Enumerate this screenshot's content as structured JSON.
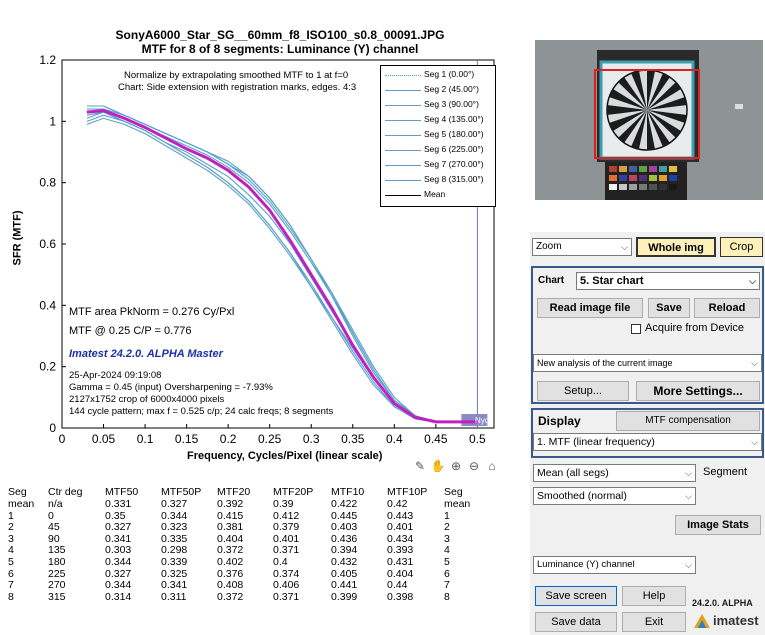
{
  "chart_title": {
    "line1": "SonyA6000_Star_SG__60mm_f8_ISO100_s0.8_00091.JPG",
    "line2": "MTF for 8 of 8 segments:  Luminance (Y) channel"
  },
  "plot_notes": {
    "normalize": "Normalize by extrapolating smoothed MTF to 1 at f=0",
    "chart_type": "Chart: Side extension with registration marks, edges. 4:3",
    "mtf_area": "MTF area PkNorm = 0.276 Cy/Pxl",
    "mtf_at": "MTF @ 0.25 C/P = 0.776",
    "version": "Imatest 24.2.0. ALPHA Master",
    "date": "25-Apr-2024 09:19:08",
    "gamma": "Gamma = 0.45 (input)  Oversharpening = -7.93%",
    "crop": "2127x1752 crop of 6000x4000 pixels",
    "pattern": "144 cycle pattern; max f = 0.525 c/p;  24 calc freqs;  8 segments",
    "nyq": "Nyq"
  },
  "legend": [
    "Seg 1 (0.00°)",
    "Seg 2 (45.00°)",
    "Seg 3 (90.00°)",
    "Seg 4 (135.00°)",
    "Seg 5 (180.00°)",
    "Seg 6 (225.00°)",
    "Seg 7 (270.00°)",
    "Seg 8 (315.00°)",
    "Mean"
  ],
  "chart_data": {
    "type": "line",
    "title": "SonyA6000_Star_SG__60mm_f8_ISO100_s0.8_00091.JPG — MTF for 8 of 8 segments:  Luminance (Y) channel",
    "xlabel": "Frequency, Cycles/Pixel (linear scale)",
    "ylabel": "SFR (MTF)",
    "xlim": [
      0,
      0.52
    ],
    "ylim": [
      0,
      1.2
    ],
    "xticks": [
      "0",
      "0.05",
      "0.1",
      "0.15",
      "0.2",
      "0.25",
      "0.3",
      "0.35",
      "0.4",
      "0.45",
      "0.5"
    ],
    "yticks": [
      "0",
      "0.2",
      "0.4",
      "0.6",
      "0.8",
      "1",
      "1.2"
    ],
    "nyquist": 0.5,
    "x": [
      0.03,
      0.05,
      0.075,
      0.1,
      0.125,
      0.15,
      0.175,
      0.2,
      0.225,
      0.25,
      0.275,
      0.3,
      0.325,
      0.35,
      0.375,
      0.4,
      0.425,
      0.45,
      0.475,
      0.5
    ],
    "series": [
      {
        "name": "Seg 1 (0.00°)",
        "color": "#5aa0c8",
        "values": [
          1.03,
          1.04,
          1.01,
          0.98,
          0.95,
          0.92,
          0.89,
          0.85,
          0.8,
          0.73,
          0.64,
          0.54,
          0.43,
          0.31,
          0.19,
          0.09,
          0.04,
          0.02,
          0.02,
          0.02
        ]
      },
      {
        "name": "Seg 2 (45.00°)",
        "color": "#5aa0c8",
        "values": [
          1.0,
          1.02,
          1.0,
          0.97,
          0.93,
          0.89,
          0.85,
          0.8,
          0.74,
          0.66,
          0.57,
          0.46,
          0.35,
          0.24,
          0.14,
          0.07,
          0.03,
          0.02,
          0.02,
          0.02
        ]
      },
      {
        "name": "Seg 3 (90.00°)",
        "color": "#5aa0c8",
        "values": [
          1.05,
          1.05,
          1.02,
          0.99,
          0.96,
          0.93,
          0.9,
          0.87,
          0.82,
          0.75,
          0.66,
          0.55,
          0.43,
          0.3,
          0.18,
          0.09,
          0.04,
          0.02,
          0.02,
          0.02
        ]
      },
      {
        "name": "Seg 4 (135.00°)",
        "color": "#5aa0c8",
        "values": [
          0.99,
          1.01,
          0.99,
          0.96,
          0.92,
          0.88,
          0.84,
          0.79,
          0.73,
          0.65,
          0.56,
          0.46,
          0.36,
          0.26,
          0.16,
          0.08,
          0.03,
          0.02,
          0.02,
          0.02
        ]
      },
      {
        "name": "Seg 5 (180.00°)",
        "color": "#5aa0c8",
        "values": [
          1.04,
          1.04,
          1.02,
          0.99,
          0.96,
          0.93,
          0.9,
          0.86,
          0.81,
          0.74,
          0.65,
          0.55,
          0.44,
          0.32,
          0.2,
          0.1,
          0.04,
          0.02,
          0.02,
          0.02
        ]
      },
      {
        "name": "Seg 6 (225.00°)",
        "color": "#5aa0c8",
        "values": [
          1.01,
          1.03,
          1.0,
          0.97,
          0.93,
          0.89,
          0.85,
          0.8,
          0.74,
          0.66,
          0.57,
          0.47,
          0.36,
          0.25,
          0.15,
          0.07,
          0.03,
          0.02,
          0.02,
          0.02
        ]
      },
      {
        "name": "Seg 7 (270.00°)",
        "color": "#5aa0c8",
        "values": [
          1.05,
          1.05,
          1.02,
          0.99,
          0.96,
          0.93,
          0.9,
          0.86,
          0.82,
          0.75,
          0.66,
          0.55,
          0.44,
          0.31,
          0.19,
          0.09,
          0.04,
          0.02,
          0.02,
          0.02
        ]
      },
      {
        "name": "Seg 8 (315.00°)",
        "color": "#5aa0c8",
        "values": [
          1.02,
          1.03,
          1.0,
          0.97,
          0.93,
          0.9,
          0.86,
          0.82,
          0.76,
          0.69,
          0.6,
          0.49,
          0.38,
          0.27,
          0.16,
          0.08,
          0.03,
          0.02,
          0.02,
          0.02
        ]
      },
      {
        "name": "Mean",
        "color": "#c020c0",
        "values": [
          1.03,
          1.035,
          1.01,
          0.98,
          0.945,
          0.91,
          0.88,
          0.84,
          0.785,
          0.71,
          0.61,
          0.5,
          0.39,
          0.27,
          0.165,
          0.08,
          0.035,
          0.02,
          0.02,
          0.02
        ]
      }
    ]
  },
  "toolbar_icons": [
    "brush-icon",
    "pan-hand-icon",
    "zoom-in-icon",
    "zoom-out-icon",
    "home-icon"
  ],
  "results_table": {
    "headers": [
      "Seg",
      "Ctr deg",
      "MTF50",
      "MTF50P",
      "MTF20",
      "MTF20P",
      "MTF10",
      "MTF10P",
      "Seg"
    ],
    "rows": [
      [
        "mean",
        "n/a",
        "0.331",
        "0.327",
        "0.392",
        "0.39",
        "0.422",
        "0.42",
        "mean"
      ],
      [
        "1",
        "0",
        "0.35",
        "0.344",
        "0.415",
        "0.412",
        "0.445",
        "0.443",
        "1"
      ],
      [
        "2",
        "45",
        "0.327",
        "0.323",
        "0.381",
        "0.379",
        "0.403",
        "0.401",
        "2"
      ],
      [
        "3",
        "90",
        "0.341",
        "0.335",
        "0.404",
        "0.401",
        "0.436",
        "0.434",
        "3"
      ],
      [
        "4",
        "135",
        "0.303",
        "0.298",
        "0.372",
        "0.371",
        "0.394",
        "0.393",
        "4"
      ],
      [
        "5",
        "180",
        "0.344",
        "0.339",
        "0.402",
        "0.4",
        "0.432",
        "0.431",
        "5"
      ],
      [
        "6",
        "225",
        "0.327",
        "0.325",
        "0.376",
        "0.374",
        "0.405",
        "0.404",
        "6"
      ],
      [
        "7",
        "270",
        "0.344",
        "0.341",
        "0.408",
        "0.406",
        "0.441",
        "0.44",
        "7"
      ],
      [
        "8",
        "315",
        "0.314",
        "0.311",
        "0.372",
        "0.371",
        "0.399",
        "0.398",
        "8"
      ]
    ]
  },
  "panel": {
    "zoom_select": "Zoom",
    "whole_img": "Whole img",
    "crop": "Crop",
    "chart_label": "Chart",
    "chart_select": "5. Star chart",
    "read_image": "Read image file",
    "save": "Save",
    "reload": "Reload",
    "acquire": "Acquire from Device",
    "analysis_select": "New analysis of the current image",
    "setup": "Setup...",
    "more_settings": "More Settings...",
    "display_label": "Display",
    "mtf_comp": "MTF compensation",
    "display_select": "1. MTF (linear frequency)",
    "mean_select": "Mean (all segs)",
    "segment_label": "Segment",
    "smooth_select": "Smoothed (normal)",
    "image_stats": "Image Stats",
    "channel_select": "Luminance (Y) channel",
    "save_screen": "Save screen",
    "help": "Help",
    "version": "24.2.0. ALPHA",
    "save_data": "Save data",
    "exit": "Exit",
    "logo": "imatest"
  },
  "colors": {
    "segment_line": "#5aa0c8",
    "mean_line": "#c020c0",
    "nyquist_line": "#7070c8",
    "whole_img_bg": "#fdf0b8",
    "panel_border": "#3a5a8c",
    "version_text": "#1c2fa6"
  }
}
